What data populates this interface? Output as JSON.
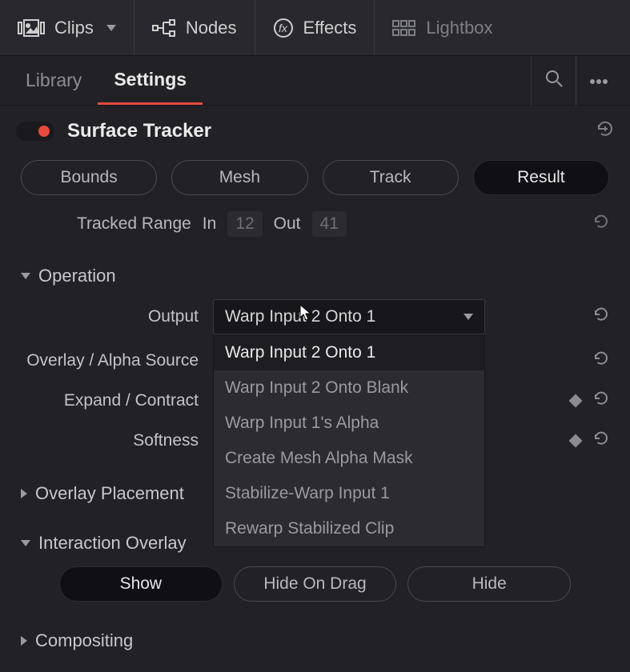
{
  "toolbar": {
    "clips": "Clips",
    "nodes": "Nodes",
    "effects": "Effects",
    "lightbox": "Lightbox"
  },
  "tabs": {
    "library": "Library",
    "settings": "Settings"
  },
  "panel": {
    "title": "Surface Tracker"
  },
  "mode_pills": {
    "bounds": "Bounds",
    "mesh": "Mesh",
    "track": "Track",
    "result": "Result"
  },
  "tracked_range": {
    "label": "Tracked Range",
    "in_label": "In",
    "in_value": "12",
    "out_label": "Out",
    "out_value": "41"
  },
  "groups": {
    "operation": "Operation",
    "overlay_placement": "Overlay Placement",
    "interaction_overlay": "Interaction Overlay",
    "compositing": "Compositing"
  },
  "params": {
    "output_label": "Output",
    "output_value": "Warp Input 2 Onto 1",
    "output_options": [
      "Warp Input 2 Onto 1",
      "Warp Input 2 Onto Blank",
      "Warp Input 1's Alpha",
      "Create Mesh Alpha Mask",
      "Stabilize-Warp Input 1",
      "Rewarp Stabilized Clip"
    ],
    "overlay_alpha_label": "Overlay / Alpha Source",
    "expand_contract_label": "Expand / Contract",
    "softness_label": "Softness"
  },
  "interaction_pills": {
    "show": "Show",
    "hide_on_drag": "Hide On Drag",
    "hide": "Hide"
  }
}
